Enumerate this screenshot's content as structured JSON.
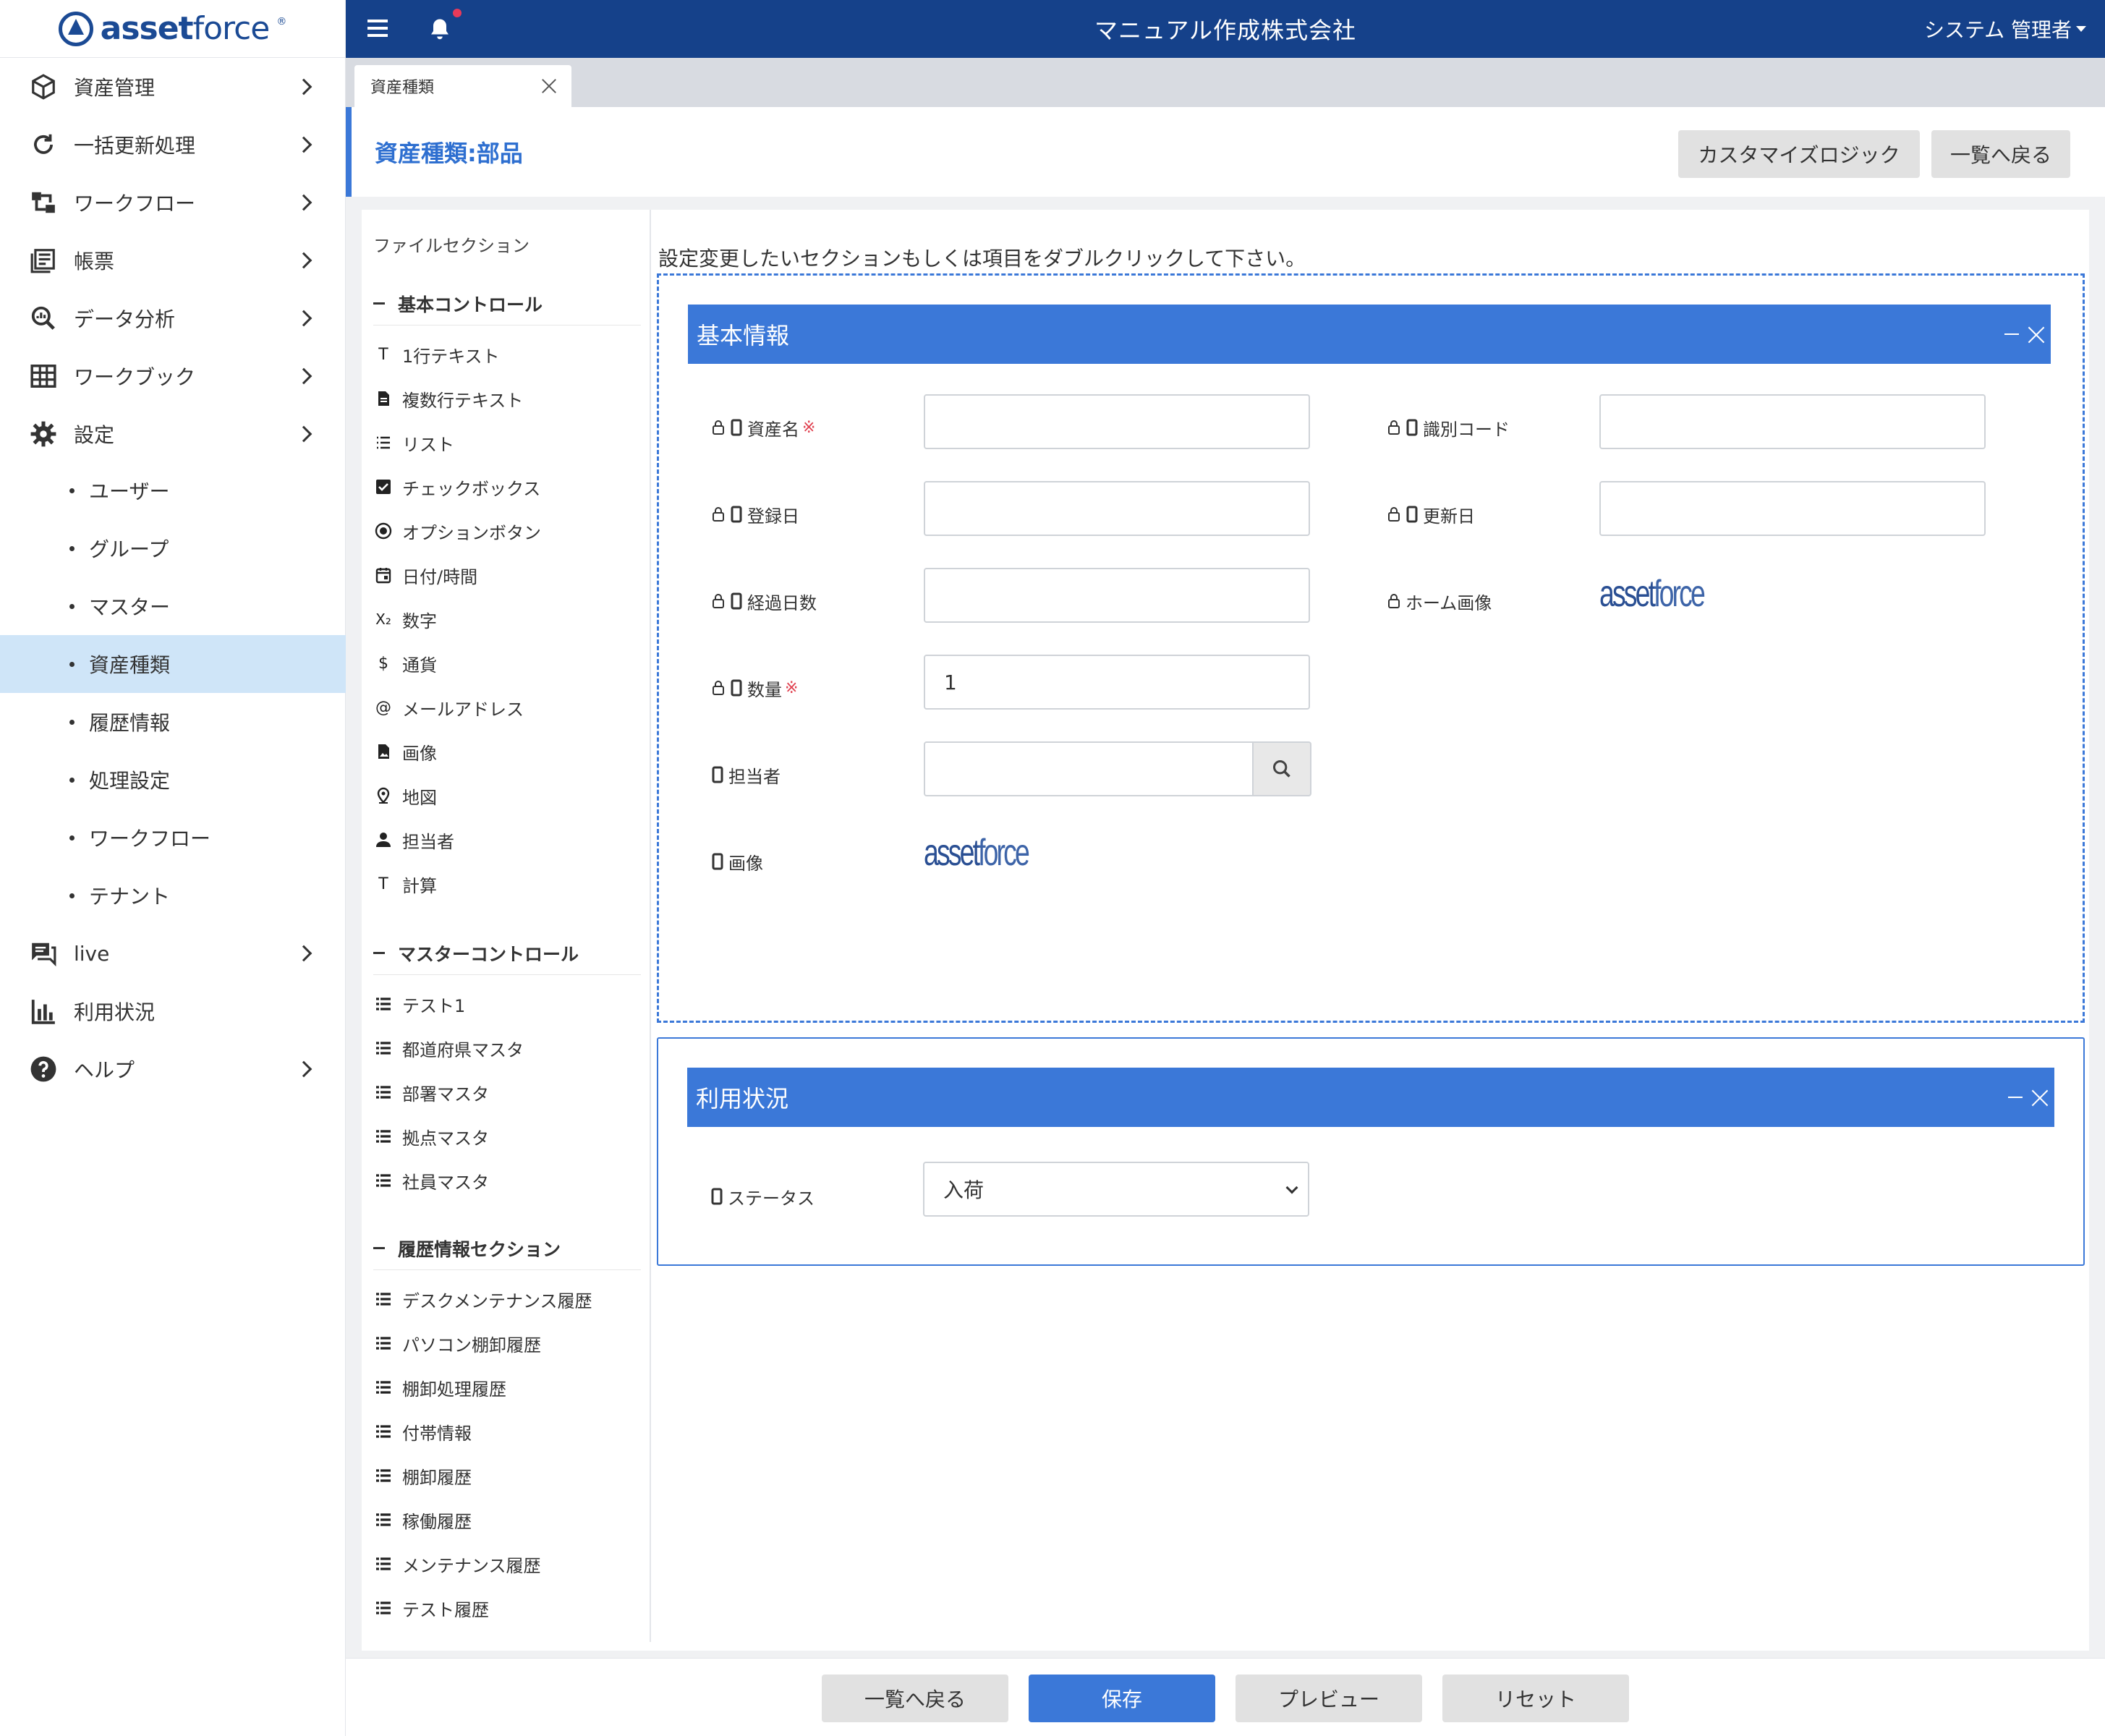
{
  "brand": {
    "logo_text_bold": "asset",
    "logo_text_thin": "force",
    "reg": "®"
  },
  "header": {
    "company": "マニュアル作成株式会社",
    "user": "システム 管理者"
  },
  "sidebar": {
    "items": [
      {
        "label": "資産管理",
        "icon": "cube-icon"
      },
      {
        "label": "一括更新処理",
        "icon": "refresh-icon"
      },
      {
        "label": "ワークフロー",
        "icon": "workflow-icon"
      },
      {
        "label": "帳票",
        "icon": "report-icon"
      },
      {
        "label": "データ分析",
        "icon": "analysis-icon"
      },
      {
        "label": "ワークブック",
        "icon": "grid-icon"
      },
      {
        "label": "設定",
        "icon": "gear-icon"
      }
    ],
    "sub_items": [
      "ユーザー",
      "グループ",
      "マスター",
      "資産種類",
      "履歴情報",
      "処理設定",
      "ワークフロー",
      "テナント"
    ],
    "bottom_items": [
      {
        "label": "live",
        "icon": "chat-icon"
      },
      {
        "label": "利用状況",
        "icon": "bar-chart-icon"
      },
      {
        "label": "ヘルプ",
        "icon": "help-icon"
      }
    ],
    "active_sub": "資産種類"
  },
  "tabs": [
    {
      "label": "資産種類"
    }
  ],
  "page": {
    "title": "資産種類:部品",
    "customize_button": "カスタマイズロジック",
    "back_button": "一覧へ戻る"
  },
  "palette": {
    "cut_item": "ファイルセクション",
    "basic_title": "基本コントロール",
    "basic": [
      {
        "label": "1行テキスト",
        "icon": "T"
      },
      {
        "label": "複数行テキスト",
        "icon": "doc"
      },
      {
        "label": "リスト",
        "icon": "list"
      },
      {
        "label": "チェックボックス",
        "icon": "check"
      },
      {
        "label": "オプションボタン",
        "icon": "radio"
      },
      {
        "label": "日付/時間",
        "icon": "calendar"
      },
      {
        "label": "数字",
        "icon": "x2"
      },
      {
        "label": "通貨",
        "icon": "$"
      },
      {
        "label": "メールアドレス",
        "icon": "@"
      },
      {
        "label": "画像",
        "icon": "image"
      },
      {
        "label": "地図",
        "icon": "pin"
      },
      {
        "label": "担当者",
        "icon": "person"
      },
      {
        "label": "計算",
        "icon": "T"
      }
    ],
    "master_title": "マスターコントロール",
    "master": [
      "テスト1",
      "都道府県マスタ",
      "部署マスタ",
      "拠点マスタ",
      "社員マスタ"
    ],
    "history_title": "履歴情報セクション",
    "history": [
      "デスクメンテナンス履歴",
      "パソコン棚卸履歴",
      "棚卸処理履歴",
      "付帯情報",
      "棚卸履歴",
      "稼働履歴",
      "メンテナンス履歴",
      "テスト履歴"
    ]
  },
  "editor": {
    "hint": "設定変更したいセクションもしくは項目をダブルクリックして下さい。",
    "section1": {
      "title": "基本情報",
      "fields": {
        "asset_name": "資産名",
        "id_code": "識別コード",
        "reg_date": "登録日",
        "upd_date": "更新日",
        "days": "経過日数",
        "home_image": "ホーム画像",
        "qty": "数量",
        "qty_value": "1",
        "owner": "担当者",
        "image": "画像"
      },
      "required_mark": "※"
    },
    "section2": {
      "title": "利用状況",
      "status_label": "ステータス",
      "status_value": "入荷"
    }
  },
  "footer": {
    "back": "一覧へ戻る",
    "save": "保存",
    "preview": "プレビュー",
    "reset": "リセット"
  },
  "colors": {
    "header": "#15418a",
    "accent": "#3b78d8",
    "active_bg": "#cfe5f8",
    "required": "#e0404f"
  }
}
